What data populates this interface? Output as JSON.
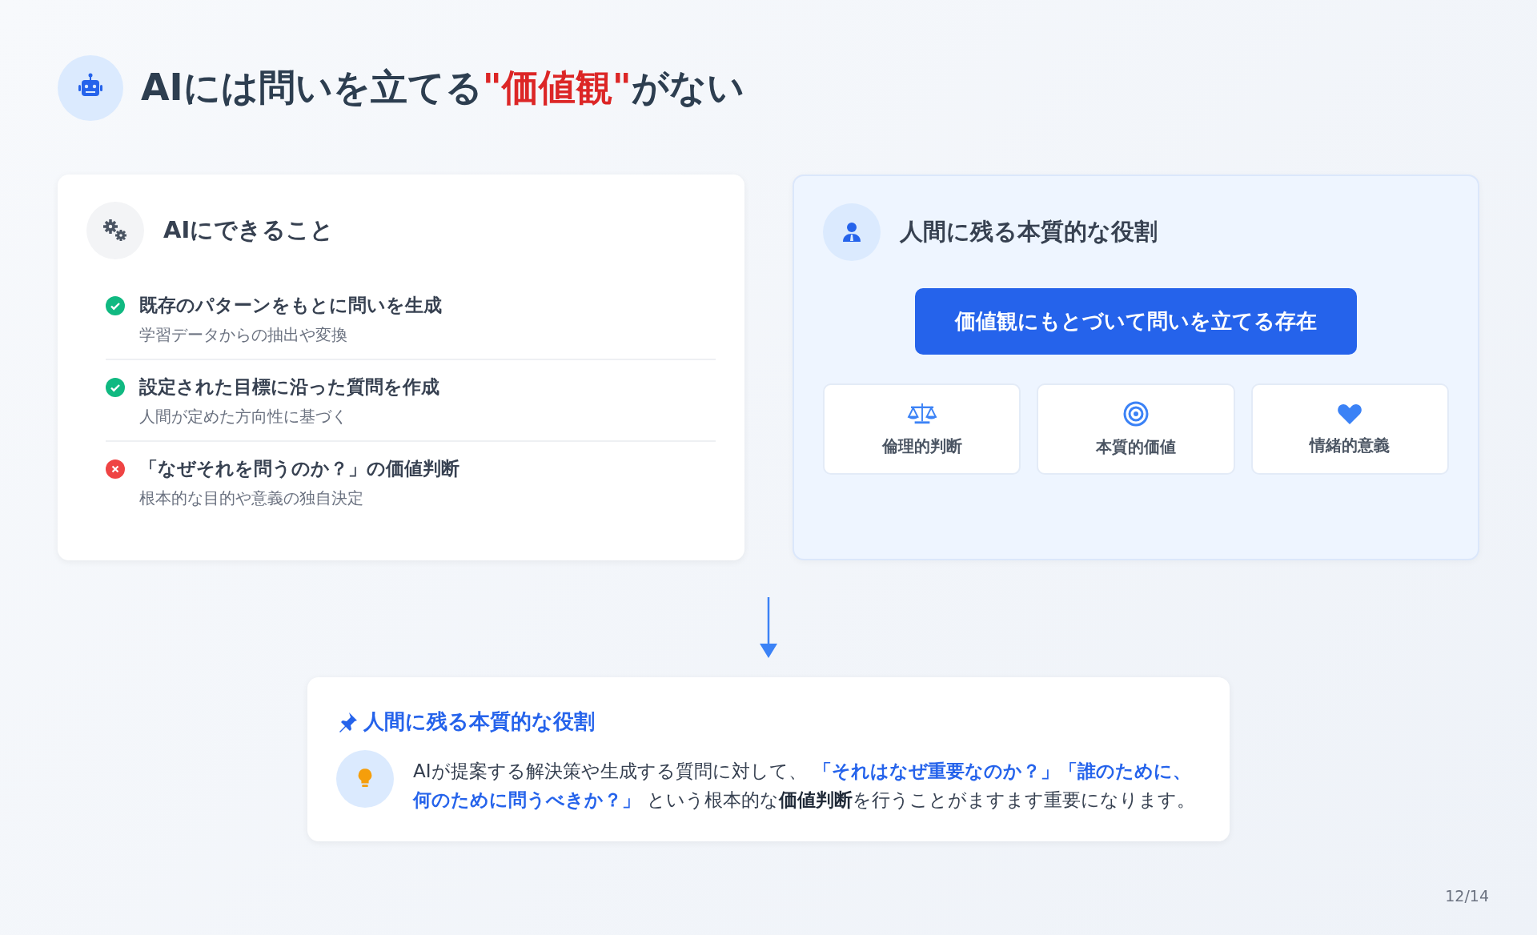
{
  "title": [
    {
      "text": "AIには問いを立てる",
      "kind": "plain"
    },
    {
      "text": "\"価値観\"",
      "kind": "accent"
    },
    {
      "text": "がない",
      "kind": "plain"
    }
  ],
  "ai_card": {
    "heading": "AIにできること",
    "items": [
      {
        "title": "既存のパターンをもとに問いを生成",
        "detail": "学習データからの抽出や変換",
        "possible": true
      },
      {
        "title": "設定された目標に沿った質問を作成",
        "detail": "人間が定めた方向性に基づく",
        "possible": true
      },
      {
        "title": "「なぜそれを問うのか？」の価値判断",
        "detail": "根本的な目的や意義の独自決定",
        "possible": false
      }
    ]
  },
  "human_card": {
    "heading": "人間に残る本質的な役割",
    "banner": "価値観にもとづいて問いを立てる存在",
    "tiles": [
      {
        "kind": "scale",
        "label": "倫理的判断"
      },
      {
        "kind": "target",
        "label": "本質的価値"
      },
      {
        "kind": "heart",
        "label": "情緒的意義"
      }
    ]
  },
  "summary": {
    "heading": "人間に残る本質的な役割",
    "body": [
      {
        "text": "AIが提案する解決策や生成する質問に対して、",
        "kind": "plain"
      },
      {
        "text": "「それはなぜ重要なのか？」「誰のために、何のために問うべきか？」",
        "kind": "quote"
      },
      {
        "text": "という根本的な",
        "kind": "plain"
      },
      {
        "text": "価値判断",
        "kind": "bold"
      },
      {
        "text": "を行うことがますます重要になります。",
        "kind": "plain"
      }
    ]
  },
  "page_number": "12/14"
}
